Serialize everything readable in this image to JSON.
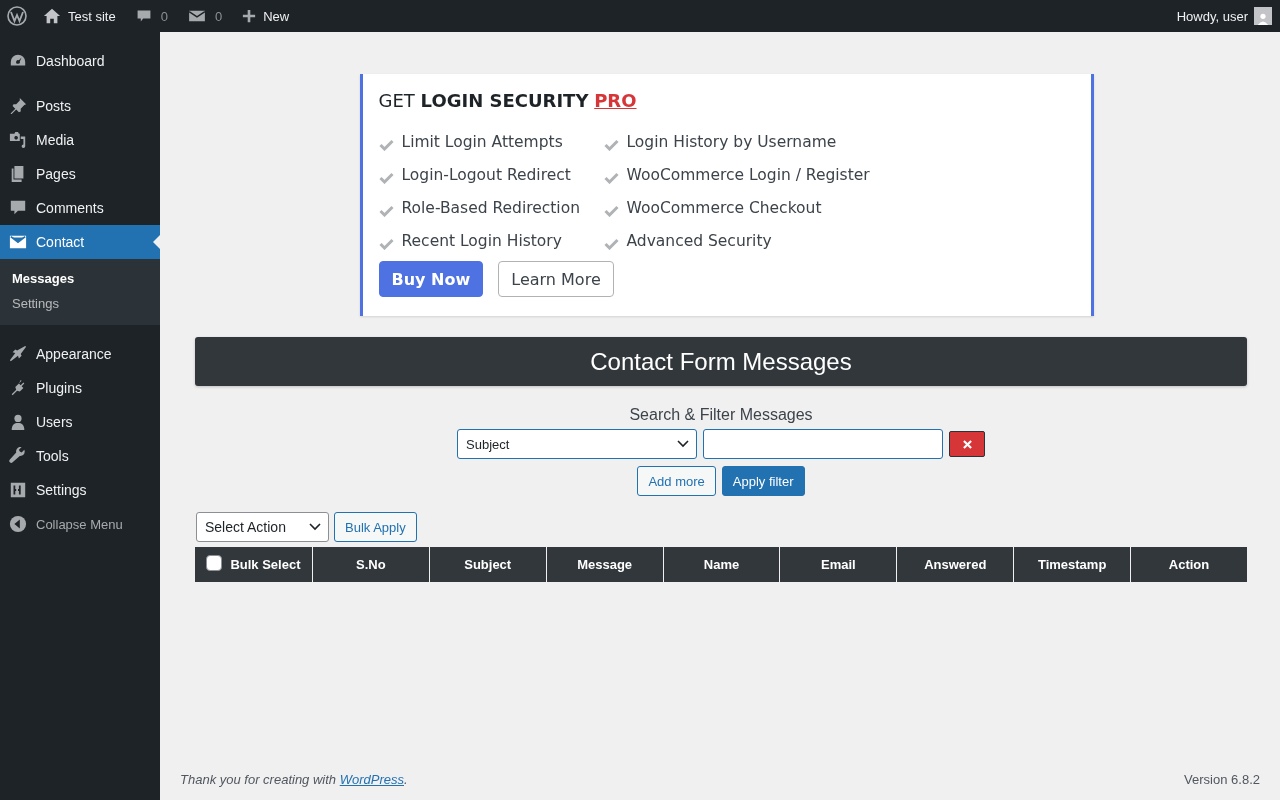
{
  "admin_bar": {
    "site": "Test site",
    "comments": "0",
    "messages": "0",
    "new": "New",
    "greeting": "Howdy, user"
  },
  "sidebar": {
    "items": [
      {
        "label": "Dashboard",
        "selected": false
      },
      {
        "label": "Posts",
        "selected": false
      },
      {
        "label": "Media",
        "selected": false
      },
      {
        "label": "Pages",
        "selected": false
      },
      {
        "label": "Comments",
        "selected": false
      },
      {
        "label": "Contact",
        "selected": true,
        "children": [
          {
            "label": "Messages",
            "selected": true
          },
          {
            "label": "Settings",
            "selected": false
          }
        ]
      },
      {
        "label": "Appearance",
        "selected": false
      },
      {
        "label": "Plugins",
        "selected": false
      },
      {
        "label": "Users",
        "selected": false
      },
      {
        "label": "Tools",
        "selected": false
      },
      {
        "label": "Settings",
        "selected": false
      }
    ],
    "collapse": "Collapse Menu"
  },
  "promo": {
    "heading": "GET **LOGIN SECURITY**",
    "pro_link": "PRO",
    "features": [
      "Limit Login Attempts",
      "Login-Logout Redirect",
      "Role-Based Redirection",
      "Recent Login History",
      "Login History by Username",
      "WooCommerce Login / Register",
      "WooCommerce Checkout",
      "Advanced Security"
    ],
    "buy_button": "Buy Now",
    "learn_button": "Learn More"
  },
  "page_title": "Contact Form Messages",
  "filter": {
    "heading": "Search & Filter Messages",
    "field": "Subject",
    "add_button": "Add more",
    "apply_button": "Apply filter"
  },
  "bulk": {
    "action": "Select Action",
    "apply_button": "Bulk Apply"
  },
  "table": {
    "select_all": {
      "label": "Bulk Select",
      "checked": false
    },
    "columns": [
      "S.No",
      "Subject",
      "Message",
      "Name",
      "Email",
      "Answered",
      "Timestamp",
      "Action"
    ]
  },
  "footer": {
    "text": "Thank you for creating with",
    "link": "WordPress",
    "after": ".",
    "version": "Version 6.8.2"
  }
}
